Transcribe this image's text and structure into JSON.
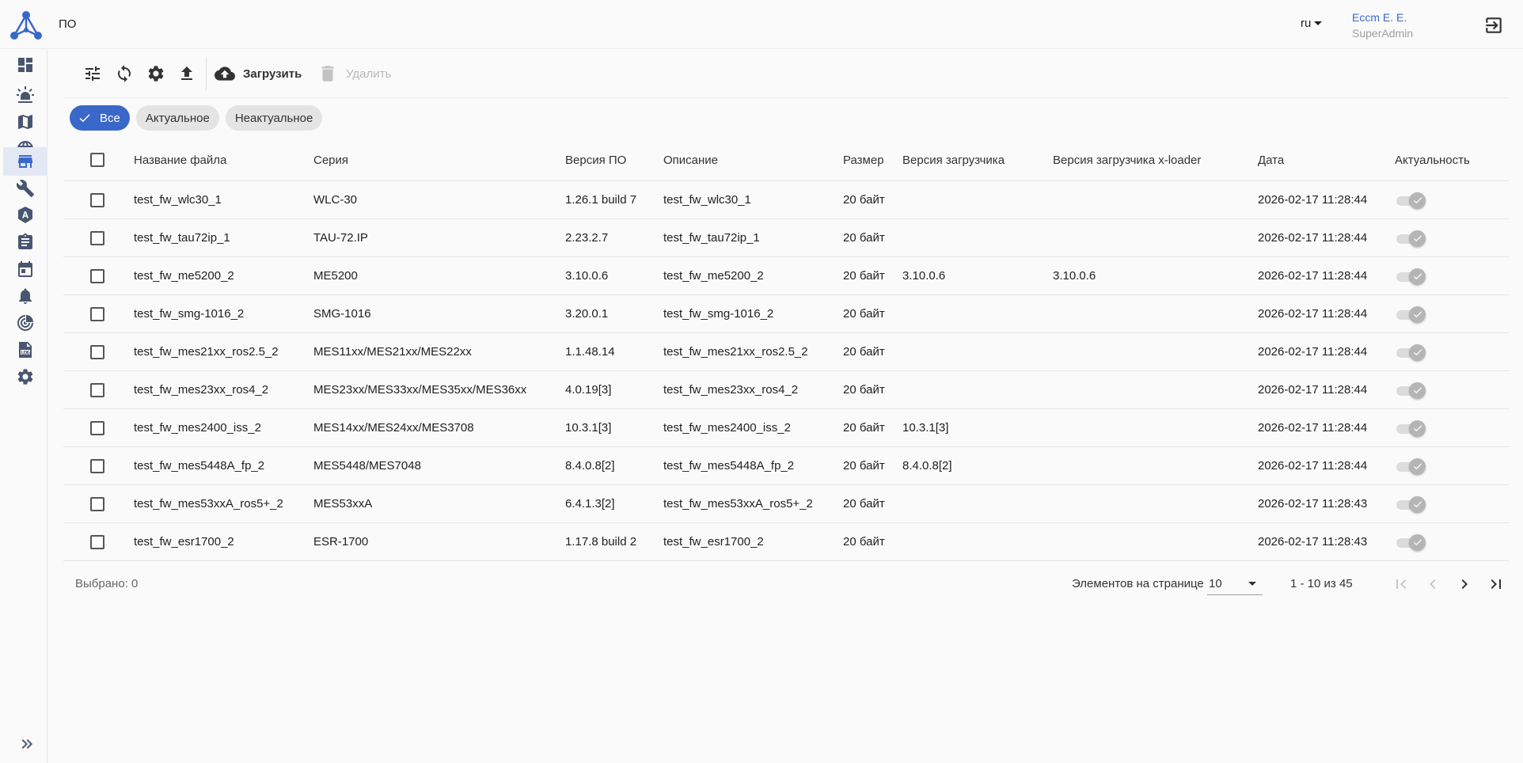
{
  "header": {
    "title": "ПО",
    "language": "ru",
    "user_name": "Еccm E. E.",
    "user_role": "SuperAdmin"
  },
  "sidebar": {
    "items": [
      {
        "icon": "dashboard-icon"
      },
      {
        "icon": "alarm-light-icon"
      },
      {
        "icon": "map-icon"
      },
      {
        "icon": "globe-icon"
      },
      {
        "icon": "store-icon",
        "active": true
      },
      {
        "icon": "wrench-icon"
      },
      {
        "icon": "auto-fix-icon"
      },
      {
        "icon": "clipboard-icon"
      },
      {
        "icon": "calendar-icon"
      },
      {
        "icon": "bell-icon"
      },
      {
        "icon": "radar-icon"
      },
      {
        "icon": "log-icon"
      },
      {
        "icon": "settings-icon"
      }
    ],
    "collapse_icon": "double-chevron-right-icon"
  },
  "toolbar": {
    "upload_label": "Загрузить",
    "delete_label": "Удалить"
  },
  "filters": {
    "all": "Все",
    "actual": "Актуальное",
    "not_actual": "Неактуальное"
  },
  "table": {
    "columns": {
      "name": "Название файла",
      "series": "Серия",
      "version": "Версия ПО",
      "description": "Описание",
      "size": "Размер",
      "bootloader": "Версия загрузчика",
      "xloader": "Версия загрузчика x-loader",
      "date": "Дата",
      "actual": "Актуальность"
    },
    "rows": [
      {
        "name": "test_fw_wlc30_1",
        "series": "WLC-30",
        "version": "1.26.1 build 7",
        "description": "test_fw_wlc30_1",
        "size": "20 байт",
        "bootloader": "",
        "xloader": "",
        "date": "2026-02-17 11:28:44"
      },
      {
        "name": "test_fw_tau72ip_1",
        "series": "TAU-72.IP",
        "version": "2.23.2.7",
        "description": "test_fw_tau72ip_1",
        "size": "20 байт",
        "bootloader": "",
        "xloader": "",
        "date": "2026-02-17 11:28:44"
      },
      {
        "name": "test_fw_me5200_2",
        "series": "ME5200",
        "version": "3.10.0.6",
        "description": "test_fw_me5200_2",
        "size": "20 байт",
        "bootloader": "3.10.0.6",
        "xloader": "3.10.0.6",
        "date": "2026-02-17 11:28:44"
      },
      {
        "name": "test_fw_smg-1016_2",
        "series": "SMG-1016",
        "version": "3.20.0.1",
        "description": "test_fw_smg-1016_2",
        "size": "20 байт",
        "bootloader": "",
        "xloader": "",
        "date": "2026-02-17 11:28:44"
      },
      {
        "name": "test_fw_mes21xx_ros2.5_2",
        "series": "MES11xx/MES21xx/MES22xx",
        "version": "1.1.48.14",
        "description": "test_fw_mes21xx_ros2.5_2",
        "size": "20 байт",
        "bootloader": "",
        "xloader": "",
        "date": "2026-02-17 11:28:44"
      },
      {
        "name": "test_fw_mes23xx_ros4_2",
        "series": "MES23xx/MES33xx/MES35xx/MES36xx",
        "version": "4.0.19[3]",
        "description": "test_fw_mes23xx_ros4_2",
        "size": "20 байт",
        "bootloader": "",
        "xloader": "",
        "date": "2026-02-17 11:28:44"
      },
      {
        "name": "test_fw_mes2400_iss_2",
        "series": "MES14xx/MES24xx/MES3708",
        "version": "10.3.1[3]",
        "description": "test_fw_mes2400_iss_2",
        "size": "20 байт",
        "bootloader": "10.3.1[3]",
        "xloader": "",
        "date": "2026-02-17 11:28:44"
      },
      {
        "name": "test_fw_mes5448A_fp_2",
        "series": "MES5448/MES7048",
        "version": "8.4.0.8[2]",
        "description": "test_fw_mes5448A_fp_2",
        "size": "20 байт",
        "bootloader": "8.4.0.8[2]",
        "xloader": "",
        "date": "2026-02-17 11:28:44"
      },
      {
        "name": "test_fw_mes53xxA_ros5+_2",
        "series": "MES53xxA",
        "version": "6.4.1.3[2]",
        "description": "test_fw_mes53xxA_ros5+_2",
        "size": "20 байт",
        "bootloader": "",
        "xloader": "",
        "date": "2026-02-17 11:28:43"
      },
      {
        "name": "test_fw_esr1700_2",
        "series": "ESR-1700",
        "version": "1.17.8 build 2",
        "description": "test_fw_esr1700_2",
        "size": "20 байт",
        "bootloader": "",
        "xloader": "",
        "date": "2026-02-17 11:28:43"
      }
    ]
  },
  "footer": {
    "selected": "Выбрано: 0",
    "per_page_label": "Элементов на странице",
    "per_page_value": "10",
    "range": "1 - 10 из 45"
  },
  "colors": {
    "accent": "#3a68c9",
    "sidebar_active_bg": "#e3e8f4"
  }
}
